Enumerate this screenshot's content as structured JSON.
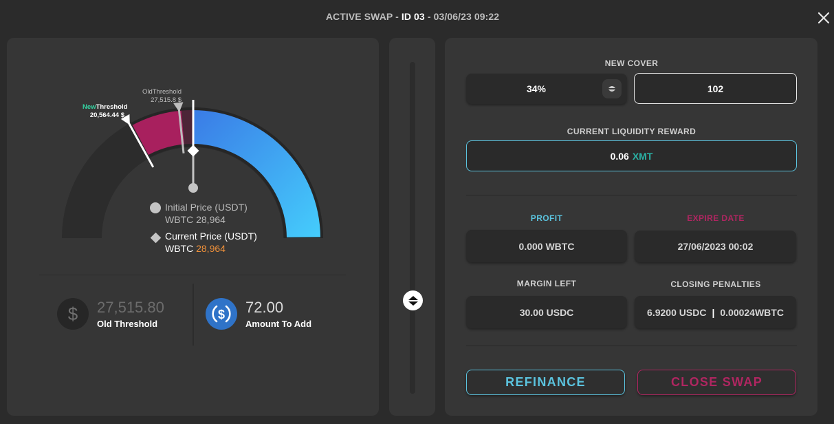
{
  "header": {
    "title_prefix": "ACTIVE SWAP - ",
    "id_label": "ID 03",
    "title_suffix": " - 03/06/23 09:22",
    "close_icon": "close-icon"
  },
  "gauge": {
    "new_threshold": {
      "label_accent": "New",
      "label_rest": "Threshold",
      "value_text": "20,564.44 $",
      "value": 20564.44
    },
    "old_threshold": {
      "label": "OldThreshold",
      "value_text": "27,515.8 $",
      "value": 27515.8
    },
    "current_price": 28964,
    "colors": {
      "accent_green": "#35d6a4",
      "magenta": "#a8205e",
      "maroon": "#4c2537",
      "blue_start": "#3a7be6",
      "blue_end": "#45cdfc"
    },
    "legend": {
      "initial_label": "Initial Price (USDT)",
      "initial_prefix": "WBTC ",
      "initial_value": "28,964",
      "current_label": "Current Price (USDT)",
      "current_prefix": "WBTC ",
      "current_value": "28,964"
    }
  },
  "stats": {
    "old_threshold": {
      "icon": "dollar-icon",
      "value": "27,515.80",
      "label": "Old Threshold"
    },
    "amount_to_add": {
      "icon": "usdc-icon",
      "value": "72.00",
      "label": "Amount To Add"
    }
  },
  "slider": {
    "icon": "up-down-arrows-icon"
  },
  "right": {
    "new_cover": {
      "label": "NEW COVER",
      "percent": "34%",
      "amount": "102"
    },
    "liquidity_reward": {
      "label": "CURRENT LIQUIDITY REWARD",
      "value": "0.06",
      "token": "XMT"
    },
    "profit": {
      "label": "PROFIT",
      "value": "0.000 WBTC"
    },
    "expire_date": {
      "label": "EXPIRE DATE",
      "value": "27/06/2023 00:02"
    },
    "margin_left": {
      "label": "MARGIN LEFT",
      "value": "30.00 USDC"
    },
    "closing_penalties": {
      "label": "CLOSING PENALTIES",
      "usdc": "6.9200 USDC",
      "separator": "|",
      "wbtc": "0.00024WBTC"
    },
    "buttons": {
      "refinance": "REFINANCE",
      "close_swap": "CLOSE SWAP"
    },
    "colors": {
      "cyan": "#5bc3de",
      "magenta": "#b02661",
      "xmt_teal": "#2ab3a6"
    }
  }
}
